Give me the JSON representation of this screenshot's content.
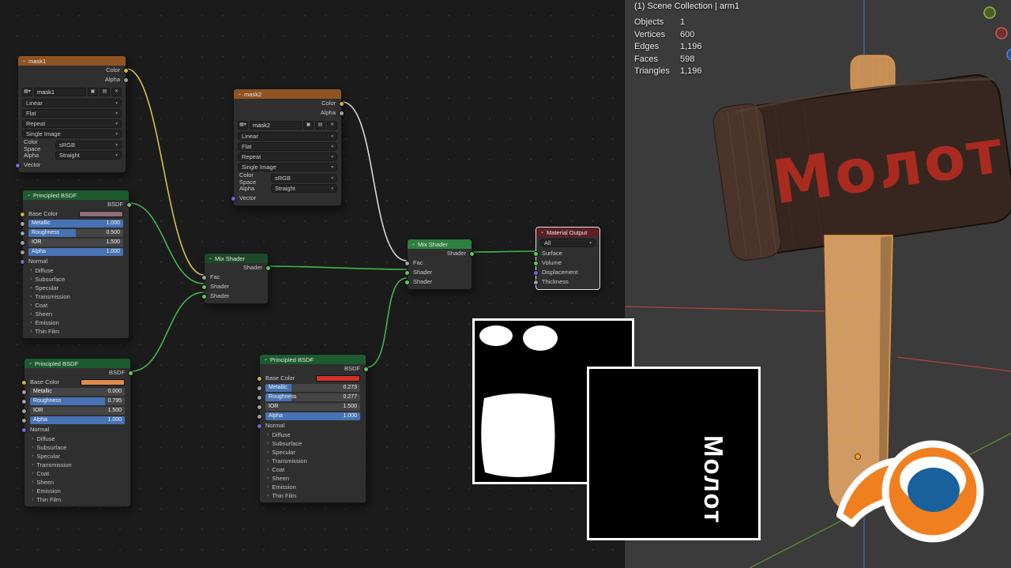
{
  "colors": {
    "header_image": "#8f5423",
    "header_shader": "#1d5b2f",
    "header_shader_dark": "#1c4a28",
    "header_shader_bright": "#2f8040",
    "header_output": "#5b1f26",
    "slider_fill": "#4772b3",
    "wire_yellow": "#cfc04e",
    "wire_gray": "#d8d8d8",
    "wire_green": "#41b64f",
    "hammer_text": "#a92a1f",
    "logo_orange": "#f0801f",
    "logo_blue": "#19619c"
  },
  "nodes": {
    "mask1": {
      "title": "mask1",
      "out_color": "Color",
      "out_alpha": "Alpha",
      "image_name": "mask1",
      "interpolation": "Linear",
      "projection": "Flat",
      "extension": "Repeat",
      "source": "Single Image",
      "color_space_label": "Color Space",
      "color_space": "sRGB",
      "alpha_label": "Alpha",
      "alpha_mode": "Straight",
      "in_vector": "Vector"
    },
    "mask2": {
      "title": "mask2",
      "out_color": "Color",
      "out_alpha": "Alpha",
      "image_name": "mask2",
      "interpolation": "Linear",
      "projection": "Flat",
      "extension": "Repeat",
      "source": "Single Image",
      "color_space_label": "Color Space",
      "color_space": "sRGB",
      "alpha_label": "Alpha",
      "alpha_mode": "Straight",
      "in_vector": "Vector"
    },
    "bsdf1": {
      "title": "Principled BSDF",
      "out_bsdf": "BSDF",
      "base_color_label": "Base Color",
      "base_color": "#8d6e79",
      "sliders": [
        {
          "label": "Metallic",
          "value": "1.000",
          "fill": 1
        },
        {
          "label": "Roughness",
          "value": "0.500",
          "fill": 0.5
        },
        {
          "label": "IOR",
          "value": "1.500",
          "fill": 0
        },
        {
          "label": "Alpha",
          "value": "1.000",
          "fill": 1
        }
      ],
      "normal_label": "Normal",
      "sections": [
        "Diffuse",
        "Subsurface",
        "Specular",
        "Transmission",
        "Coat",
        "Sheen",
        "Emission",
        "Thin Film"
      ]
    },
    "bsdf2": {
      "title": "Principled BSDF",
      "out_bsdf": "BSDF",
      "base_color_label": "Base Color",
      "base_color": "#e08b4d",
      "sliders": [
        {
          "label": "Metallic",
          "value": "0.000",
          "fill": 0
        },
        {
          "label": "Roughness",
          "value": "0.795",
          "fill": 0.795
        },
        {
          "label": "IOR",
          "value": "1.500",
          "fill": 0
        },
        {
          "label": "Alpha",
          "value": "1.000",
          "fill": 1
        }
      ],
      "normal_label": "Normal",
      "sections": [
        "Diffuse",
        "Subsurface",
        "Specular",
        "Transmission",
        "Coat",
        "Sheen",
        "Emission",
        "Thin Film"
      ]
    },
    "bsdf3": {
      "title": "Principled BSDF",
      "out_bsdf": "BSDF",
      "base_color_label": "Base Color",
      "base_color": "#d42f28",
      "sliders": [
        {
          "label": "Metallic",
          "value": "0.273",
          "fill": 0.273
        },
        {
          "label": "Roughness",
          "value": "0.277",
          "fill": 0.277
        },
        {
          "label": "IOR",
          "value": "1.500",
          "fill": 0
        },
        {
          "label": "Alpha",
          "value": "1.000",
          "fill": 1
        }
      ],
      "normal_label": "Normal",
      "sections": [
        "Diffuse",
        "Subsurface",
        "Specular",
        "Transmission",
        "Coat",
        "Sheen",
        "Emission",
        "Thin Film"
      ]
    },
    "mix1": {
      "title": "Mix Shader",
      "out_shader": "Shader",
      "in_fac": "Fac",
      "in_shader1": "Shader",
      "in_shader2": "Shader"
    },
    "mix2": {
      "title": "Mix Shader",
      "out_shader": "Shader",
      "in_fac": "Fac",
      "in_shader1": "Shader",
      "in_shader2": "Shader"
    },
    "output": {
      "title": "Material Output",
      "target": "All",
      "in_surface": "Surface",
      "in_volume": "Volume",
      "in_displacement": "Displacement",
      "in_thickness": "Thickness"
    }
  },
  "viewport": {
    "header": "(1) Scene Collection | arm1",
    "stats": [
      {
        "label": "Objects",
        "value": "1"
      },
      {
        "label": "Vertices",
        "value": "600"
      },
      {
        "label": "Edges",
        "value": "1,196"
      },
      {
        "label": "Faces",
        "value": "598"
      },
      {
        "label": "Triangles",
        "value": "1,196"
      }
    ],
    "hammer_label": "Молот"
  },
  "previews": {
    "text_label": "Молот"
  }
}
